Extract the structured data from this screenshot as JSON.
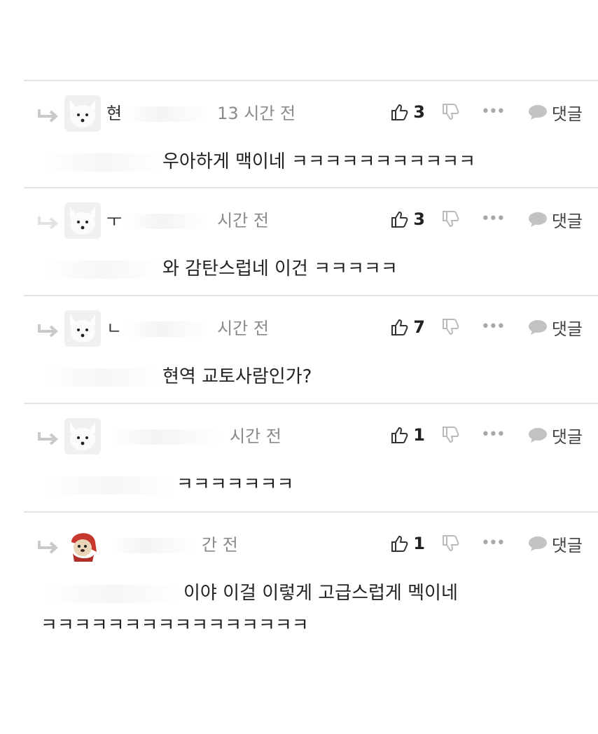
{
  "actions": {
    "reply_label": "댓글",
    "more_label": "•••"
  },
  "comments": [
    {
      "name": "현",
      "time": "13 시간 전",
      "likes": "3",
      "text_visible": "우아하게 맥이네 ㅋㅋㅋㅋㅋㅋㅋㅋㅋㅋㅋ",
      "text_line2": "",
      "avatar": "white-fox-avatar"
    },
    {
      "name": "ㅜ",
      "time": "시간 전",
      "likes": "3",
      "text_visible": "와 감탄스럽네 이건 ㅋㅋㅋㅋㅋ",
      "text_line2": "",
      "avatar": "white-fox-avatar"
    },
    {
      "name": "ㄴ",
      "time": "시간 전",
      "likes": "7",
      "text_visible": "현역 교토사람인가?",
      "text_line2": "",
      "avatar": "white-fox-avatar"
    },
    {
      "name": "",
      "time": "시간 전",
      "likes": "1",
      "text_visible": "ㅋㅋㅋㅋㅋㅋㅋ",
      "text_line2": "",
      "avatar": "white-fox-avatar"
    },
    {
      "name": "",
      "time": "간 전",
      "likes": "1",
      "text_visible": "이야 이걸 이렇게 고급스럽게 멕이네",
      "text_line2": "ㅋㅋㅋㅋㅋㅋㅋㅋㅋㅋㅋㅋㅋㅋㅋㅋ",
      "avatar": "red-hood-dog-avatar"
    }
  ]
}
